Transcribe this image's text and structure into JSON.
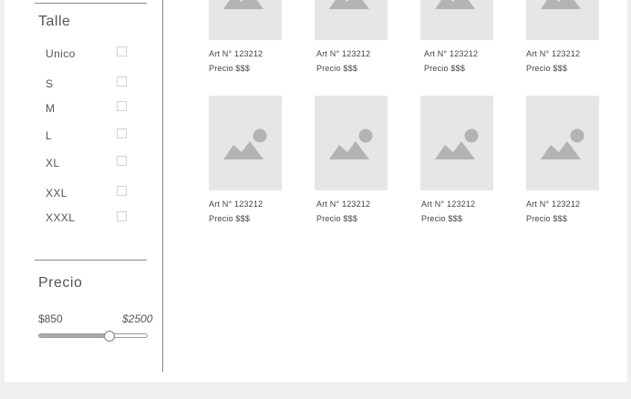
{
  "sidebar": {
    "size_section": {
      "title": "Talle",
      "options": [
        {
          "label": "Unico",
          "checked": false
        },
        {
          "label": "S",
          "checked": false
        },
        {
          "label": "M",
          "checked": false
        },
        {
          "label": "L",
          "checked": false
        },
        {
          "label": "XL",
          "checked": false
        },
        {
          "label": "XXL",
          "checked": false
        },
        {
          "label": "XXXL",
          "checked": false
        }
      ]
    },
    "price_section": {
      "title": "Precio",
      "min_label": "$850",
      "max_label": "$2500",
      "slider_fraction": 0.65
    }
  },
  "products": [
    {
      "art": "Art N° 123212",
      "price": "Precio $$$",
      "image_icon": "image-placeholder-icon"
    },
    {
      "art": "Art N° 123212",
      "price": "Precio $$$",
      "image_icon": "image-placeholder-icon"
    },
    {
      "art": "Art N° 123212",
      "price": "Precio $$$",
      "image_icon": "image-placeholder-icon"
    },
    {
      "art": "Art N° 123212",
      "price": "Precio $$$",
      "image_icon": "image-placeholder-icon"
    },
    {
      "art": "Art N° 123212",
      "price": "Precio $$$",
      "image_icon": "image-placeholder-icon"
    },
    {
      "art": "Art N° 123212",
      "price": "Precio $$$",
      "image_icon": "image-placeholder-icon"
    },
    {
      "art": "Art N° 123212",
      "price": "Precio $$$",
      "image_icon": "image-placeholder-icon"
    },
    {
      "art": "Art N° 123212",
      "price": "Precio $$$",
      "image_icon": "image-placeholder-icon"
    }
  ],
  "colors": {
    "placeholder_bg": "#e6e6e6",
    "placeholder_shape": "#b3b3b3",
    "divider": "#8a8a8a"
  }
}
